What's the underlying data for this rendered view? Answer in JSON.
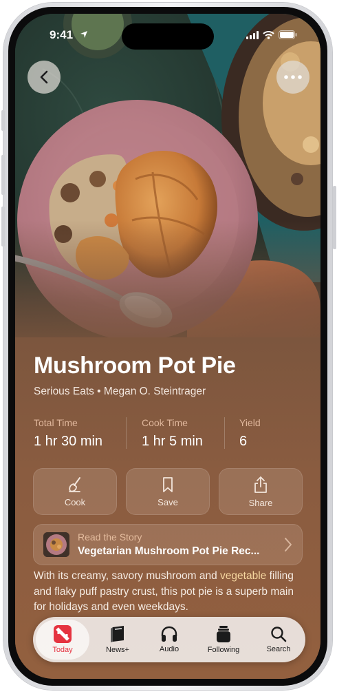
{
  "status_bar": {
    "time": "9:41"
  },
  "recipe": {
    "title": "Mushroom Pot Pie",
    "byline": "Serious Eats • Megan O. Steintrager",
    "stats": [
      {
        "label": "Total Time",
        "value": "1 hr 30 min"
      },
      {
        "label": "Cook Time",
        "value": "1 hr 5 min"
      },
      {
        "label": "Yield",
        "value": "6"
      }
    ],
    "actions": [
      {
        "label": "Cook",
        "icon": "whisk-icon"
      },
      {
        "label": "Save",
        "icon": "bookmark-icon"
      },
      {
        "label": "Share",
        "icon": "share-icon"
      }
    ],
    "story": {
      "kicker": "Read the Story",
      "title": "Vegetarian Mushroom Pot Pie Rec..."
    },
    "description_pre": "With its creamy, savory mushroom and ",
    "description_highlight": "vegetable",
    "description_post": " filling and flaky puff pastry crust, this pot pie is a superb main for holidays and even weekdays."
  },
  "tab_bar": {
    "items": [
      {
        "label": "Today",
        "icon": "news-logo-icon",
        "active": true
      },
      {
        "label": "News+",
        "icon": "magazine-icon",
        "active": false
      },
      {
        "label": "Audio",
        "icon": "headphones-icon",
        "active": false
      },
      {
        "label": "Following",
        "icon": "following-icon",
        "active": false
      },
      {
        "label": "Search",
        "icon": "search-icon",
        "active": false
      }
    ]
  },
  "colors": {
    "accent_red": "#e53340",
    "stat_label": "#e0b79c",
    "highlight_text": "#f6d7a0"
  }
}
